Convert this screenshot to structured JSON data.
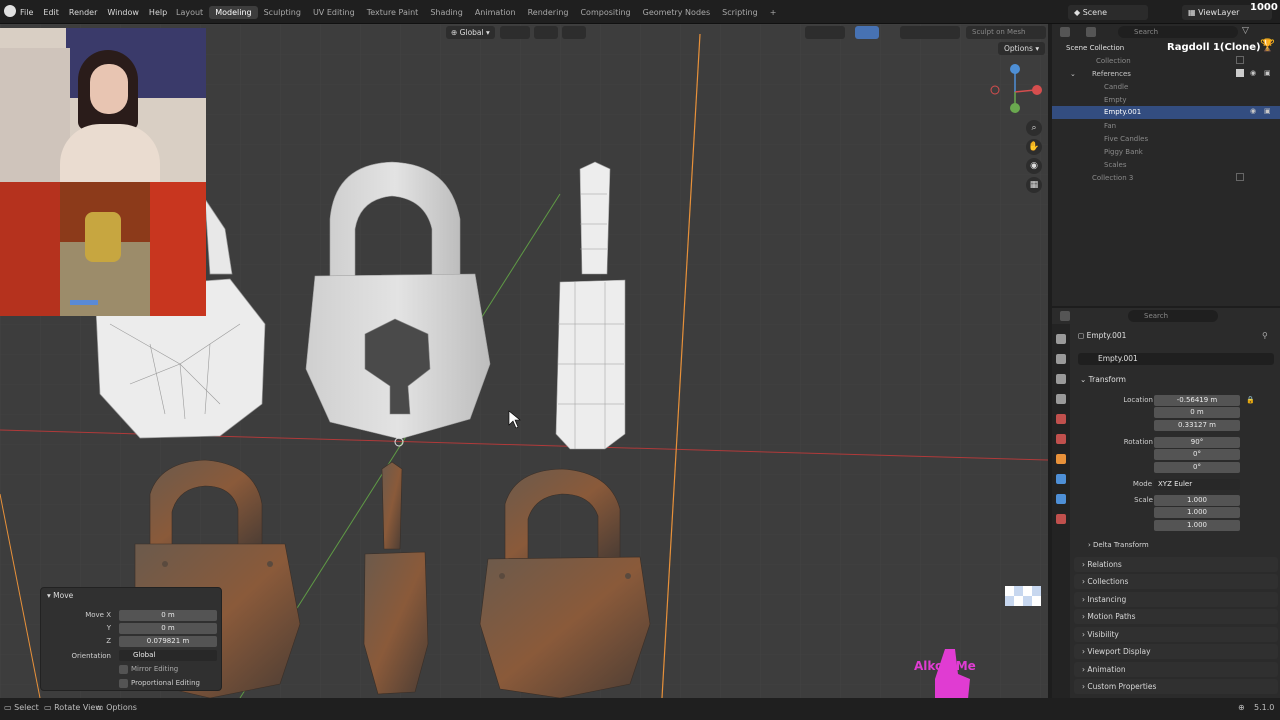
{
  "menu": [
    "File",
    "Edit",
    "Render",
    "Window",
    "Help"
  ],
  "workspaces": [
    "Layout",
    "Modeling",
    "Sculpting",
    "UV Editing",
    "Texture Paint",
    "Shading",
    "Animation",
    "Rendering",
    "Compositing",
    "Geometry Nodes",
    "Scripting"
  ],
  "active_workspace": "Modeling",
  "scene": {
    "name": "Scene",
    "view_layer": "ViewLayer",
    "counter": "1000"
  },
  "viewport": {
    "orientation": "Global",
    "sculpt_on_mesh": "Sculpt on Mesh",
    "options": "Options",
    "watermark": "Alkoli Me"
  },
  "outliner": {
    "search_placeholder": "Search",
    "title": "Scene Collection",
    "badge": "Ragdoll 1(Clone)",
    "rows": [
      {
        "label": "Collection",
        "indent": 1,
        "dim": true
      },
      {
        "label": "References",
        "indent": 1,
        "dim": false
      },
      {
        "label": "Candle",
        "indent": 2,
        "dim": true
      },
      {
        "label": "Empty",
        "indent": 2,
        "dim": true
      },
      {
        "label": "Empty.001",
        "indent": 2,
        "dim": false,
        "selected": true
      },
      {
        "label": "Fan",
        "indent": 2,
        "dim": true
      },
      {
        "label": "Five Candles",
        "indent": 2,
        "dim": true
      },
      {
        "label": "Piggy Bank",
        "indent": 2,
        "dim": true
      },
      {
        "label": "Scales",
        "indent": 2,
        "dim": true
      },
      {
        "label": "Collection 3",
        "indent": 1,
        "dim": true
      }
    ]
  },
  "properties": {
    "search_placeholder": "Search",
    "object_name": "Empty.001",
    "object_field": "Empty.001",
    "transform_title": "Transform",
    "location_label": "Location X",
    "location": [
      "-0.56419 m",
      "0 m",
      "0.33127 m"
    ],
    "rotation_label": "Rotation X",
    "rotation": [
      "90°",
      "0°",
      "0°"
    ],
    "mode_label": "Mode",
    "mode": "XYZ Euler",
    "scale_label": "Scale X",
    "scale": [
      "1.000",
      "1.000",
      "1.000"
    ],
    "axis_y": "Y",
    "axis_z": "Z",
    "panels": [
      "Delta Transform",
      "Relations",
      "Collections",
      "Instancing",
      "Motion Paths",
      "Visibility",
      "Viewport Display",
      "Animation",
      "Custom Properties"
    ]
  },
  "operator": {
    "title": "Move",
    "move_x_label": "Move X",
    "move_x": "0 m",
    "move_y_label": "Y",
    "move_y": "0 m",
    "move_z_label": "Z",
    "move_z": "0.079821 m",
    "orientation_label": "Orientation",
    "orientation": "Global",
    "mirror": "Mirror Editing",
    "proportional": "Proportional Editing"
  },
  "status": {
    "select": "Select",
    "rotate": "Rotate View",
    "options": "Options",
    "version": "5.1.0"
  },
  "colors": {
    "accent": "#4772b3",
    "selected_row": "#334d80",
    "x_axis": "#c0392b",
    "y_axis": "#6aa84f",
    "z_axis": "#e8913a",
    "watermark": "#e03cd2"
  }
}
